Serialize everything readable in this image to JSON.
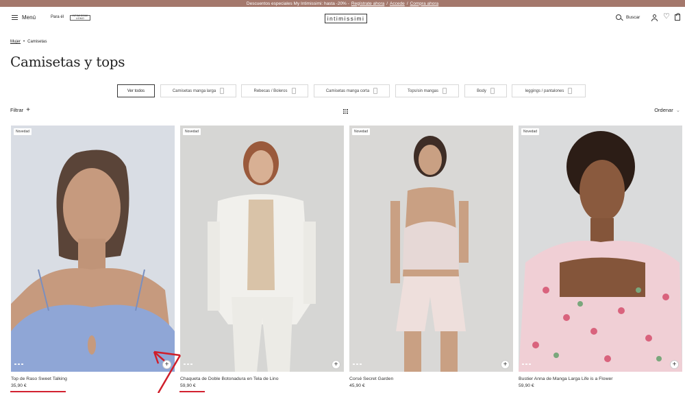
{
  "promo": {
    "text": "Descuentos especiales My Intimissimi: hasta -20% -",
    "register": "Regístrate ahora",
    "sep1": "/",
    "login": "Accede",
    "sep2": "/",
    "buy": "Compra ahora"
  },
  "header": {
    "menu_label": "Menú",
    "para_el": "Para él",
    "intimi_line1": "INTIMISSIMI",
    "intimi_line2": "UOMO",
    "brand": "intimissimi",
    "search_label": "Buscar",
    "heart_glyph": "♡"
  },
  "breadcrumb": {
    "home": "Mujer",
    "sep": "•",
    "current": "Camisetas"
  },
  "page_title": "Camisetas y tops",
  "categories": [
    "Ver todos",
    "Camisetas manga larga",
    "Rebecas / Boleros",
    "Camisetas manga corta",
    "Tops/sin mangas",
    "Body",
    "leggings / pantalones"
  ],
  "toolbar": {
    "filter_label": "Filtrar",
    "filter_plus": "+",
    "sort_label": "Ordenar",
    "sort_chevron": "⌄"
  },
  "products": [
    {
      "badge": "Novedad",
      "name": "Top de Raso Sweet Talking",
      "price": "35,90 €"
    },
    {
      "badge": "Novedad",
      "name": "Chaqueta de Doble Botonadura en Tela de Lino",
      "price": "59,90 €"
    },
    {
      "badge": "Novedad",
      "name": "Corsé Secret Garden",
      "price": "45,90 €"
    },
    {
      "badge": "Novedad",
      "name": "Bustier Anna de Manga Larga Life is a Flower",
      "price": "59,90 €"
    }
  ],
  "add_glyph": "+",
  "colors": {
    "promo_bg": "#a4786c",
    "accent_underline": "#d2202e",
    "annotation_arrow": "#cf1f2b"
  }
}
